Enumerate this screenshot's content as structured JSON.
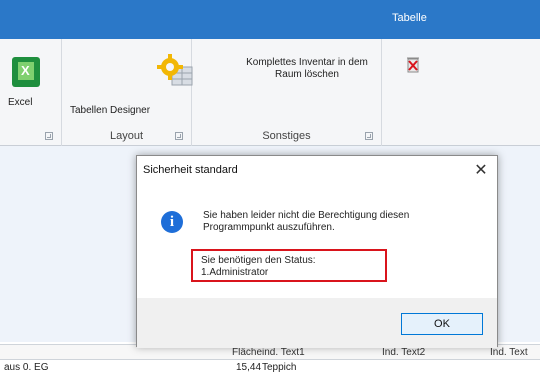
{
  "titlebar": {
    "context_tab": "Tabelle"
  },
  "ribbon": {
    "export_group": {
      "excel_label": "Excel"
    },
    "layout_group": {
      "label": "Layout",
      "designer_label": "Tabellen Designer"
    },
    "misc_group": {
      "label": "Sonstiges",
      "delete_inventory_label": "Komplettes Inventar in dem Raum löschen"
    }
  },
  "grid": {
    "columns": [
      "Flächeind. Text1",
      "Ind. Text2",
      "Ind. Text"
    ],
    "first_row": {
      "room_partial": "aus 0. EG",
      "value": "15,44",
      "text": "Teppich"
    }
  },
  "dialog": {
    "title": "Sicherheit standard",
    "close_glyph": "✕",
    "message": "Sie haben leider nicht die Berechtigung diesen Programmpunkt auszuführen.",
    "status_line1": "Sie benötigen den Status:",
    "status_line2": "1.Administrator",
    "ok_label": "OK"
  },
  "colors": {
    "accent": "#2b78c8",
    "highlight_border": "#d9141c",
    "info_icon": "#1e6ed8"
  }
}
